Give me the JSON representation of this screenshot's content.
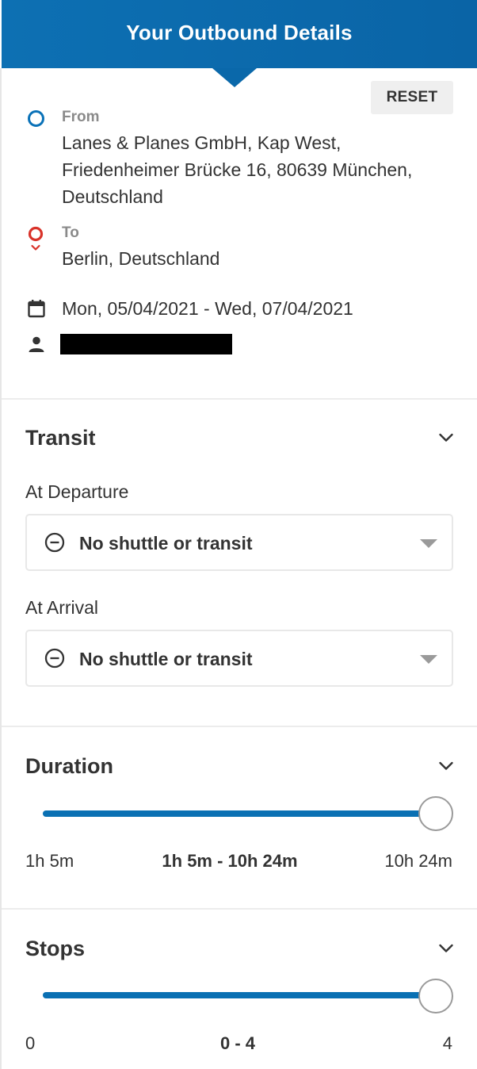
{
  "header": {
    "title": "Your Outbound Details"
  },
  "reset_label": "RESET",
  "route": {
    "from_label": "From",
    "from_lines": [
      "Lanes & Planes GmbH, Kap West,",
      "Friedenheimer Brücke 16, 80639 München,",
      "Deutschland"
    ],
    "to_label": "To",
    "to_value": "Berlin, Deutschland"
  },
  "dates": "Mon, 05/04/2021 - Wed, 07/04/2021",
  "icons": {
    "from": "ring-icon",
    "to": "location-pin-icon",
    "date": "calendar-icon",
    "traveler": "person-icon",
    "expand": "chevron-down-icon",
    "no_transit": "minus-circle-icon",
    "dropdown": "caret-down-icon"
  },
  "colors": {
    "brand": "#0a6aad",
    "origin": "#0a72b8",
    "destination": "#d9332a"
  },
  "transit": {
    "title": "Transit",
    "departure_label": "At Departure",
    "departure_value": "No shuttle or transit",
    "arrival_label": "At Arrival",
    "arrival_value": "No shuttle or transit"
  },
  "duration": {
    "title": "Duration",
    "min": "1h 5m",
    "range": "1h 5m - 10h 24m",
    "max": "10h 24m",
    "selected_fraction": 1.0
  },
  "stops": {
    "title": "Stops",
    "min": "0",
    "range": "0 - 4",
    "max": "4",
    "selected_fraction": 1.0
  }
}
